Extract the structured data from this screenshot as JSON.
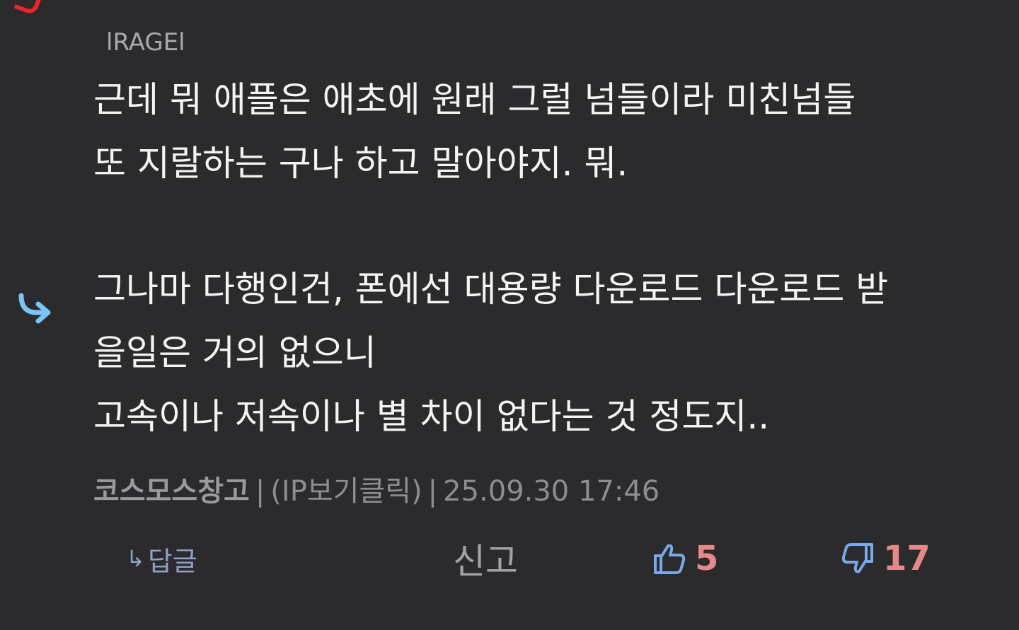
{
  "quote": {
    "author": "lRAGEl",
    "lines": [
      "근데 뭐 애플은 애초에 원래 그럴 넘들이라 미친넘들",
      "또 지랄하는 구나 하고 말아야지. 뭐."
    ]
  },
  "comment": {
    "lines": [
      "그나마 다행인건, 폰에선 대용량 다운로드 다운로드 받",
      "을일은 거의 없으니",
      "고속이나 저속이나 별 차이 없다는 것 정도지.."
    ],
    "nickname": "코스모스창고",
    "separator": "|",
    "ip_label": "(IP보기클릭)",
    "date": "25.09.30 17:46"
  },
  "actions": {
    "reply_arrow": "↳",
    "reply_label": "답글",
    "report_label": "신고",
    "like_count": "5",
    "dislike_count": "17"
  },
  "icons": {
    "reply": "reply-arrow-icon",
    "like": "thumbs-up-icon",
    "dislike": "thumbs-down-icon"
  },
  "colors": {
    "background": "#2b2b2e",
    "text": "#f4f4f4",
    "meta": "#8d8d90",
    "reply_arrow": "#7cc4f4",
    "link": "#8f9fc8",
    "count": "#e58a8a",
    "thumb_icon": "#7aa8e8",
    "accent_red": "#e8262b"
  }
}
